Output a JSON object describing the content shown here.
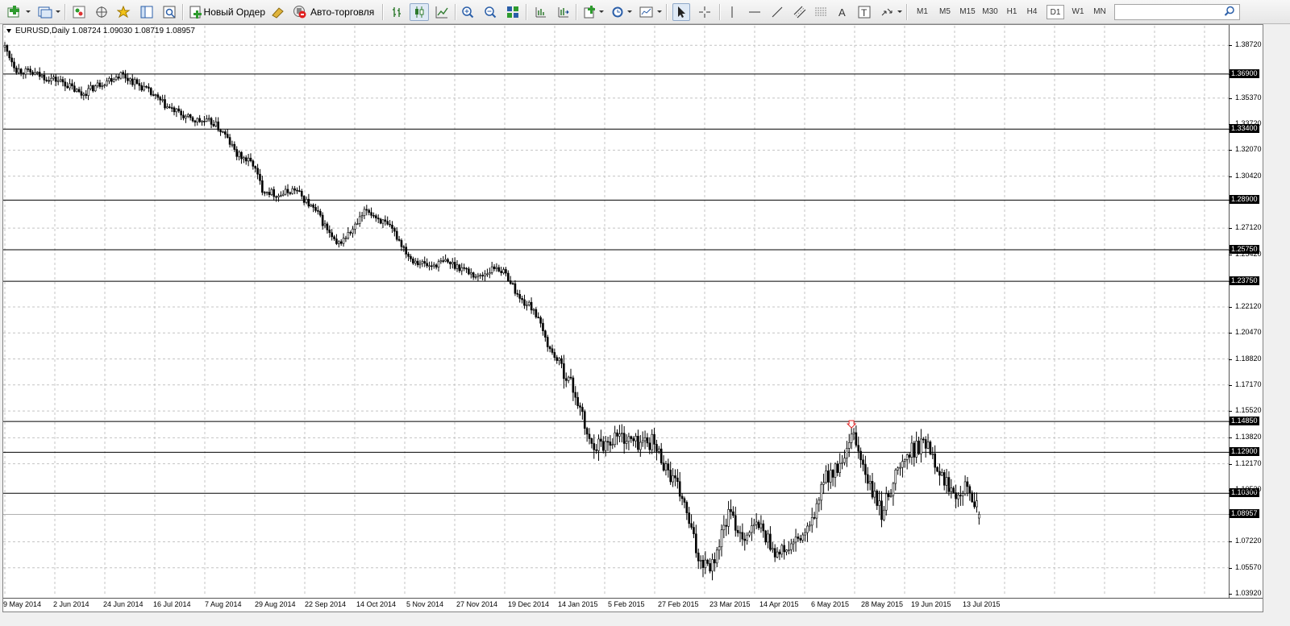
{
  "toolbar": {
    "new_order_label": "Новый Ордер",
    "autotrading_label": "Авто-торговля",
    "timeframes": [
      {
        "label": "M1",
        "active": false
      },
      {
        "label": "M5",
        "active": false
      },
      {
        "label": "M15",
        "active": false
      },
      {
        "label": "M30",
        "active": false
      },
      {
        "label": "H1",
        "active": false
      },
      {
        "label": "H4",
        "active": false
      },
      {
        "label": "D1",
        "active": true
      },
      {
        "label": "W1",
        "active": false
      },
      {
        "label": "MN",
        "active": false
      }
    ],
    "search_placeholder": "",
    "icons": [
      "new-chart-icon",
      "profiles-icon",
      "market-watch-icon",
      "navigator-icon",
      "favorites-icon",
      "data-window-icon",
      "strategy-tester-icon",
      "new-order-icon",
      "metaeditor-icon",
      "autotrading-icon",
      "bar-chart-icon",
      "candlestick-icon",
      "line-chart-icon",
      "zoom-in-icon",
      "zoom-out-icon",
      "tile-windows-icon",
      "chart-shift-icon",
      "autoscroll-icon",
      "indicators-icon",
      "periods-icon",
      "templates-icon",
      "cursor-icon",
      "crosshair-icon",
      "vertical-line-icon",
      "horizontal-line-icon",
      "trendline-icon",
      "equidistant-channel-icon",
      "fibonacci-icon",
      "text-icon",
      "text-label-icon",
      "arrows-icon",
      "search-icon"
    ]
  },
  "chart": {
    "symbol_line": "EURUSD,Daily  1.08724 1.09030 1.08719 1.08957",
    "price_labels": [
      "1.38720",
      "1.36900",
      "1.35370",
      "1.33720",
      "1.33400",
      "1.32070",
      "1.30420",
      "1.28900",
      "1.27120",
      "1.25750",
      "1.25420",
      "1.23750",
      "1.22120",
      "1.20470",
      "1.18820",
      "1.17170",
      "1.15520",
      "1.14850",
      "1.13820",
      "1.12900",
      "1.12170",
      "1.10300",
      "1.10520",
      "1.08957",
      "1.07220",
      "1.05570",
      "1.03920"
    ],
    "date_labels": [
      "9 May 2014",
      "2 Jun 2014",
      "24 Jun 2014",
      "16 Jul 2014",
      "7 Aug 2014",
      "29 Aug 2014",
      "22 Sep 2014",
      "14 Oct 2014",
      "5 Nov 2014",
      "27 Nov 2014",
      "19 Dec 2014",
      "14 Jan 2015",
      "5 Feb 2015",
      "27 Feb 2015",
      "23 Mar 2015",
      "14 Apr 2015",
      "6 May 2015",
      "28 May 2015",
      "19 Jun 2015",
      "13 Jul 2015"
    ],
    "horizontal_levels": [
      "1.36900",
      "1.33400",
      "1.28900",
      "1.25750",
      "1.23750",
      "1.14850",
      "1.12900",
      "1.10300"
    ],
    "current_price": "1.08957",
    "colors": {
      "background": "#ffffff",
      "grid": "#c0c0c0",
      "candle": "#000000",
      "level_label_bg": "#000000",
      "level_label_fg": "#ffffff",
      "marker": "#ff0000"
    }
  },
  "chart_data": {
    "type": "candlestick",
    "symbol": "EURUSD",
    "timeframe": "Daily",
    "ylim": [
      1.0392,
      1.3955
    ],
    "last_bar": {
      "open": 1.08724,
      "high": 1.0903,
      "low": 1.08719,
      "close": 1.08957
    },
    "horizontal_lines": [
      1.369,
      1.334,
      1.289,
      1.2575,
      1.2375,
      1.1485,
      1.129,
      1.103
    ],
    "anchors": [
      {
        "i": 0,
        "p": 1.386
      },
      {
        "i": 5,
        "p": 1.372
      },
      {
        "i": 15,
        "p": 1.368
      },
      {
        "i": 25,
        "p": 1.364
      },
      {
        "i": 33,
        "p": 1.356
      },
      {
        "i": 40,
        "p": 1.362
      },
      {
        "i": 50,
        "p": 1.369
      },
      {
        "i": 60,
        "p": 1.36
      },
      {
        "i": 70,
        "p": 1.348
      },
      {
        "i": 80,
        "p": 1.34
      },
      {
        "i": 90,
        "p": 1.338
      },
      {
        "i": 95,
        "p": 1.33
      },
      {
        "i": 100,
        "p": 1.318
      },
      {
        "i": 107,
        "p": 1.312
      },
      {
        "i": 111,
        "p": 1.296
      },
      {
        "i": 118,
        "p": 1.292
      },
      {
        "i": 125,
        "p": 1.296
      },
      {
        "i": 135,
        "p": 1.28
      },
      {
        "i": 143,
        "p": 1.26
      },
      {
        "i": 150,
        "p": 1.27
      },
      {
        "i": 156,
        "p": 1.283
      },
      {
        "i": 163,
        "p": 1.275
      },
      {
        "i": 168,
        "p": 1.268
      },
      {
        "i": 175,
        "p": 1.252
      },
      {
        "i": 183,
        "p": 1.247
      },
      {
        "i": 190,
        "p": 1.25
      },
      {
        "i": 197,
        "p": 1.246
      },
      {
        "i": 204,
        "p": 1.24
      },
      {
        "i": 212,
        "p": 1.247
      },
      {
        "i": 217,
        "p": 1.24
      },
      {
        "i": 222,
        "p": 1.226
      },
      {
        "i": 228,
        "p": 1.22
      },
      {
        "i": 235,
        "p": 1.194
      },
      {
        "i": 240,
        "p": 1.184
      },
      {
        "i": 246,
        "p": 1.166
      },
      {
        "i": 252,
        "p": 1.135
      },
      {
        "i": 258,
        "p": 1.134
      },
      {
        "i": 264,
        "p": 1.14
      },
      {
        "i": 272,
        "p": 1.135
      },
      {
        "i": 279,
        "p": 1.136
      },
      {
        "i": 285,
        "p": 1.12
      },
      {
        "i": 292,
        "p": 1.1
      },
      {
        "i": 299,
        "p": 1.062
      },
      {
        "i": 305,
        "p": 1.058
      },
      {
        "i": 312,
        "p": 1.09
      },
      {
        "i": 318,
        "p": 1.076
      },
      {
        "i": 325,
        "p": 1.083
      },
      {
        "i": 333,
        "p": 1.064
      },
      {
        "i": 340,
        "p": 1.07
      },
      {
        "i": 347,
        "p": 1.08
      },
      {
        "i": 354,
        "p": 1.114
      },
      {
        "i": 361,
        "p": 1.12
      },
      {
        "i": 366,
        "p": 1.14
      },
      {
        "i": 372,
        "p": 1.11
      },
      {
        "i": 378,
        "p": 1.09
      },
      {
        "i": 384,
        "p": 1.115
      },
      {
        "i": 391,
        "p": 1.13
      },
      {
        "i": 398,
        "p": 1.136
      },
      {
        "i": 404,
        "p": 1.113
      },
      {
        "i": 410,
        "p": 1.104
      },
      {
        "i": 415,
        "p": 1.11
      },
      {
        "i": 420,
        "p": 1.0896
      }
    ],
    "sell_marker": {
      "i": 365,
      "p": 1.146
    }
  }
}
